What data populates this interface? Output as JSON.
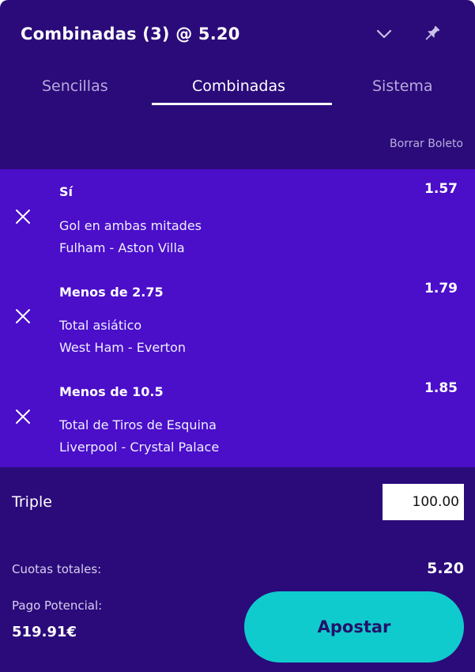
{
  "header": {
    "title": "Combinadas (3) @ 5.20"
  },
  "tabs": [
    {
      "label": "Sencillas"
    },
    {
      "label": "Combinadas"
    },
    {
      "label": "Sistema"
    }
  ],
  "clear_label": "Borrar Boleto",
  "selections": [
    {
      "pick": "Sí",
      "market": "Gol en ambas mitades",
      "event": "Fulham - Aston Villa",
      "odds": "1.57"
    },
    {
      "pick": "Menos de 2.75",
      "market": "Total asiático",
      "event": "West Ham - Everton",
      "odds": "1.79"
    },
    {
      "pick": "Menos de 10.5",
      "market": "Total de Tiros de Esquina",
      "event": "Liverpool - Crystal Palace",
      "odds": "1.85"
    }
  ],
  "stake": {
    "bet_type": "Triple",
    "value": "100.00"
  },
  "summary": {
    "total_odds_label": "Cuotas totales:",
    "total_odds": "5.20",
    "payout_label": "Pago Potencial:",
    "payout": "519.91€"
  },
  "place_bet_label": "Apostar",
  "colors": {
    "panel_bg": "#2b0b7a",
    "selection_bg": "#4b0ec9",
    "accent_button": "#10cbcd",
    "inactive_tab": "#b7a9db"
  },
  "icons": {
    "collapse": "chevron-down-icon",
    "pin": "pin-icon",
    "remove": "close-icon"
  }
}
